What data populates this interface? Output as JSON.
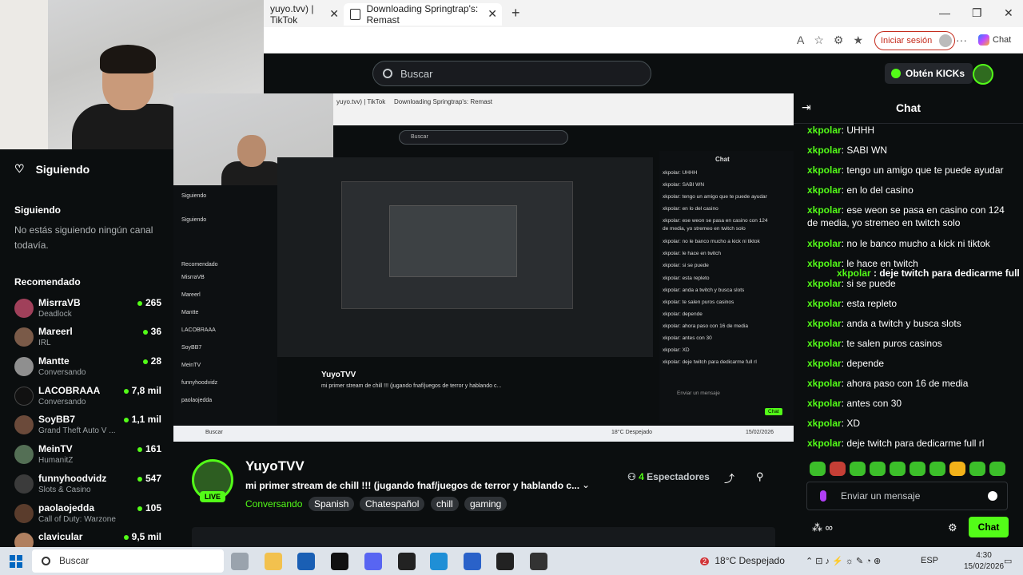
{
  "browser": {
    "tabs": [
      {
        "label": "yuyo.tvv) | TikTok"
      },
      {
        "label": "Downloading Springtrap's: Remast"
      }
    ],
    "login_label": "Iniciar sesión",
    "chat_label": "Chat"
  },
  "kick_header": {
    "search_placeholder": "Buscar",
    "kicks_label": "Obtén KICKs"
  },
  "sidebar": {
    "following_header": "Siguiendo",
    "following_section": "Siguiendo",
    "following_empty": "No estás siguiendo ningún canal todavía.",
    "recommended_section": "Recomendado",
    "channels": [
      {
        "name": "MisrraVB",
        "category": "Deadlock",
        "viewers": "265"
      },
      {
        "name": "Mareerl",
        "category": "IRL",
        "viewers": "36"
      },
      {
        "name": "Mantte",
        "category": "Conversando",
        "viewers": "28"
      },
      {
        "name": "LACOBRAAA",
        "category": "Conversando",
        "viewers": "7,8 mil"
      },
      {
        "name": "SoyBB7",
        "category": "Grand Theft Auto V ...",
        "viewers": "1,1 mil"
      },
      {
        "name": "MeinTV",
        "category": "HumanitZ",
        "viewers": "161"
      },
      {
        "name": "funnyhoodvidz",
        "category": "Slots & Casino",
        "viewers": "547"
      },
      {
        "name": "paolaojedda",
        "category": "Call of Duty: Warzone",
        "viewers": "105"
      },
      {
        "name": "clavicular",
        "category": "",
        "viewers": "9,5 mil"
      }
    ]
  },
  "chat": {
    "title": "Chat",
    "messages": [
      {
        "user": "xkpolar",
        "text": ": UHHH"
      },
      {
        "user": "xkpolar",
        "text": ": SABI WN"
      },
      {
        "user": "xkpolar",
        "text": ": tengo un amigo que te puede ayudar"
      },
      {
        "user": "xkpolar",
        "text": ": en lo del casino"
      },
      {
        "user": "xkpolar",
        "text": ": ese weon se pasa en casino con 124 de media, yo stremeo en twitch solo"
      },
      {
        "user": "xkpolar",
        "text": ": no le banco mucho a kick ni tiktok"
      },
      {
        "user": "xkpolar",
        "text": ": le hace en twitch"
      },
      {
        "user": "xkpolar",
        "text": ": si se puede"
      },
      {
        "user": "xkpolar",
        "text": ": esta repleto"
      },
      {
        "user": "xkpolar",
        "text": ": anda a twitch y busca slots"
      },
      {
        "user": "xkpolar",
        "text": ": te salen puros casinos"
      },
      {
        "user": "xkpolar",
        "text": ": depende"
      },
      {
        "user": "xkpolar",
        "text": ": ahora paso con 16 de media"
      },
      {
        "user": "xkpolar",
        "text": ": antes con 30"
      },
      {
        "user": "xkpolar",
        "text": ": XD"
      },
      {
        "user": "xkpolar",
        "text": ": deje twitch para dedicarme full rl"
      }
    ],
    "overlay": {
      "user": "xkpolar",
      "text": " : deje twitch para dedicarme full"
    },
    "input_placeholder": "Enviar un mensaje",
    "send_label": "Chat"
  },
  "stream": {
    "streamer": "YuyoTVV",
    "live_label": "LIVE",
    "title": "mi primer stream de chill !!! (jugando fnaf/juegos de terror y hablando c...",
    "category": "Conversando",
    "tags": [
      "Spanish",
      "Chatespañol",
      "chill",
      "gaming"
    ],
    "viewers_count": "4",
    "viewers_label": "Espectadores"
  },
  "nested": {
    "chat_lines": [
      "xkpolar: UHHH",
      "xkpolar: SABI WN",
      "xkpolar: tengo un amigo que te puede ayudar",
      "xkpolar: en lo del casino",
      "xkpolar: ese weon se pasa en casino con 124",
      "de media, yo stremeo en twitch solo",
      "xkpolar: no le banco mucho a kick ni tiktok",
      "xkpolar: le hace en twitch",
      "xkpolar: si se puede",
      "xkpolar: esta repleto",
      "xkpolar: anda a twitch y busca slots",
      "xkpolar: te salen puros casinos",
      "xkpolar: depende",
      "xkpolar: ahora paso con 16 de media",
      "xkpolar: antes con 30",
      "xkpolar: XD",
      "xkpolar: deje twitch para dedicarme full rl"
    ]
  },
  "taskbar": {
    "search_label": "Buscar",
    "weather": "18°C  Despejado",
    "weather_badge": "2",
    "lang": "ESP",
    "time": "4:30",
    "date": "15/02/2026"
  },
  "colors": {
    "accent": "#53fc18",
    "bg": "#0b0e0f"
  }
}
